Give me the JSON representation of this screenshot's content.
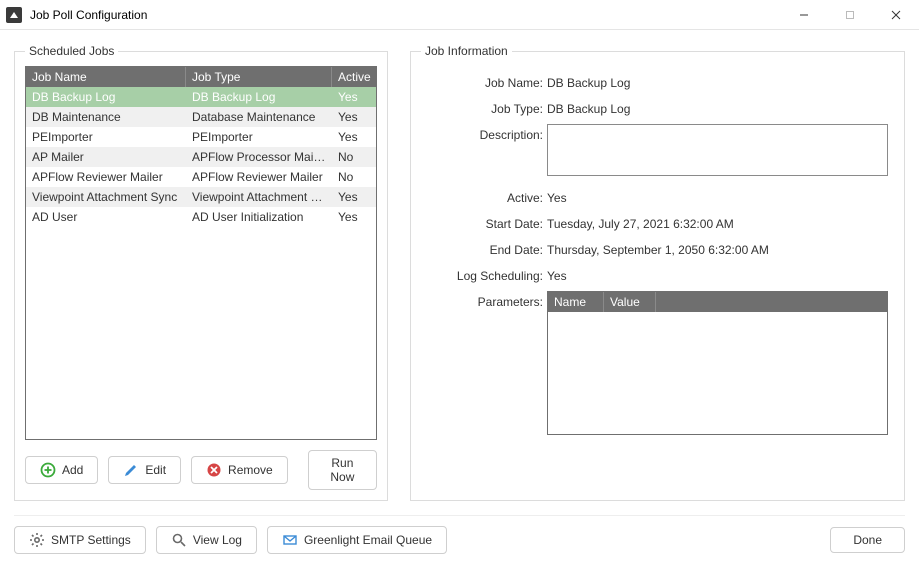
{
  "window": {
    "title": "Job Poll Configuration"
  },
  "scheduled": {
    "legend": "Scheduled Jobs",
    "headers": {
      "name": "Job Name",
      "type": "Job Type",
      "active": "Active"
    },
    "rows": [
      {
        "name": "DB Backup Log",
        "type": "DB Backup Log",
        "active": "Yes"
      },
      {
        "name": "DB Maintenance",
        "type": "Database Maintenance",
        "active": "Yes"
      },
      {
        "name": "PEImporter",
        "type": "PEImporter",
        "active": "Yes"
      },
      {
        "name": "AP Mailer",
        "type": "APFlow Processor Mailer",
        "active": "No"
      },
      {
        "name": "APFlow Reviewer Mailer",
        "type": "APFlow Reviewer Mailer",
        "active": "No"
      },
      {
        "name": "Viewpoint Attachment Sync",
        "type": "Viewpoint Attachment Sync",
        "active": "Yes"
      },
      {
        "name": "AD User",
        "type": "AD User Initialization",
        "active": "Yes"
      }
    ],
    "buttons": {
      "add": "Add",
      "edit": "Edit",
      "remove": "Remove",
      "run": "Run Now"
    }
  },
  "info": {
    "legend": "Job Information",
    "labels": {
      "name": "Job Name:",
      "type": "Job Type:",
      "description": "Description:",
      "active": "Active:",
      "start": "Start Date:",
      "end": "End Date:",
      "log": "Log Scheduling:",
      "params": "Parameters:"
    },
    "values": {
      "name": "DB Backup Log",
      "type": "DB Backup Log",
      "description": "",
      "active": "Yes",
      "start": "Tuesday, July 27, 2021 6:32:00 AM",
      "end": "Thursday, September 1, 2050 6:32:00 AM",
      "log": "Yes"
    },
    "params_headers": {
      "name": "Name",
      "value": "Value"
    }
  },
  "footer": {
    "smtp": "SMTP Settings",
    "viewlog": "View Log",
    "queue": "Greenlight Email Queue",
    "done": "Done"
  }
}
